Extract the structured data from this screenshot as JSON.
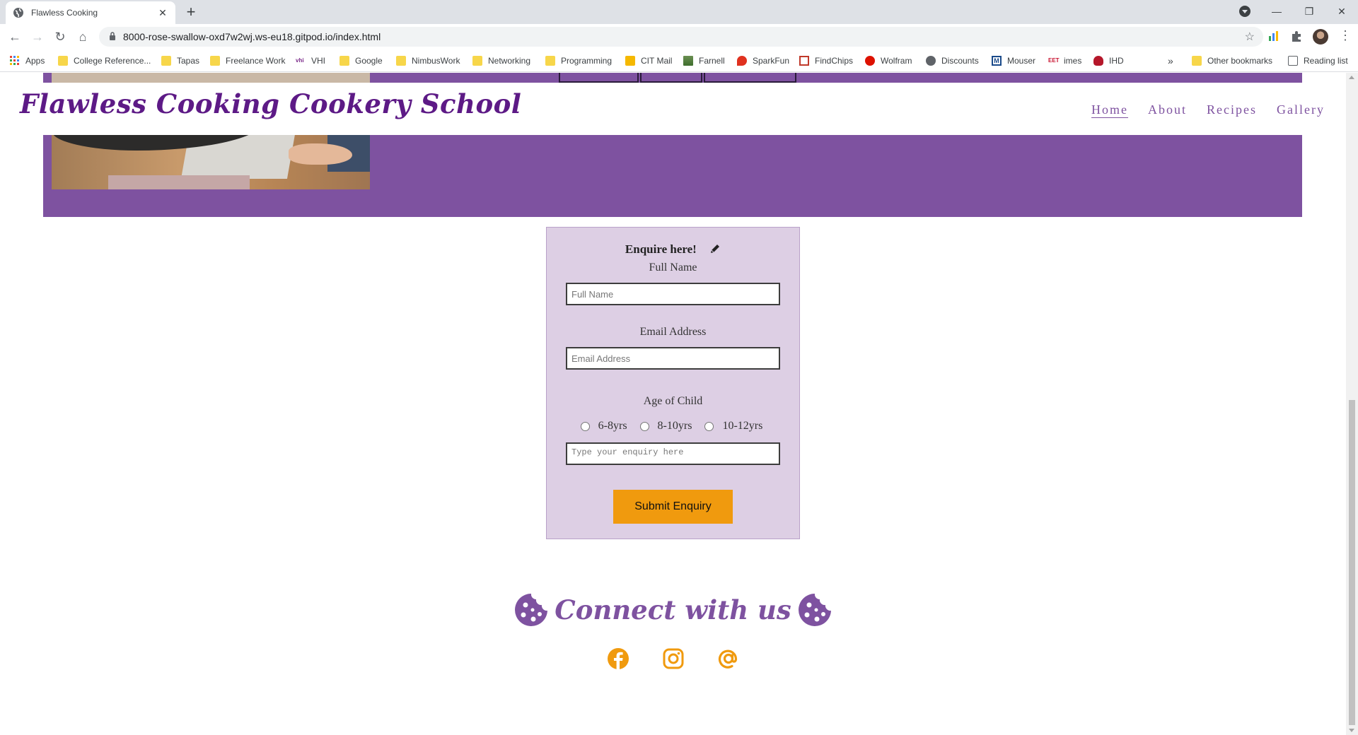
{
  "browser": {
    "tab_title": "Flawless Cooking",
    "url": "8000-rose-swallow-oxd7w2wj.ws-eu18.gitpod.io/index.html",
    "bookmarks": [
      {
        "label": "Apps",
        "icon": "apps-grid-icon"
      },
      {
        "label": "College Reference...",
        "icon": "folder-icon"
      },
      {
        "label": "Tapas",
        "icon": "folder-icon"
      },
      {
        "label": "Freelance Work",
        "icon": "folder-icon"
      },
      {
        "label": "VHI",
        "icon": "vhi-icon"
      },
      {
        "label": "Google",
        "icon": "folder-icon"
      },
      {
        "label": "NimbusWork",
        "icon": "folder-icon"
      },
      {
        "label": "Networking",
        "icon": "folder-icon"
      },
      {
        "label": "Programming",
        "icon": "folder-icon"
      },
      {
        "label": "CIT Mail",
        "icon": "cit-icon"
      },
      {
        "label": "Farnell",
        "icon": "farnell-icon"
      },
      {
        "label": "SparkFun",
        "icon": "sparkfun-icon"
      },
      {
        "label": "FindChips",
        "icon": "findchips-icon"
      },
      {
        "label": "Wolfram",
        "icon": "wolfram-icon"
      },
      {
        "label": "Discounts",
        "icon": "globe-icon"
      },
      {
        "label": "Mouser",
        "icon": "mouser-icon"
      },
      {
        "label": "imes",
        "icon": "eet-icon"
      },
      {
        "label": "IHD",
        "icon": "ihd-icon"
      }
    ],
    "more_bookmarks": "»",
    "other_bookmarks": "Other bookmarks",
    "reading_list": "Reading list"
  },
  "site": {
    "brand": "Flawless Cooking Cookery School",
    "nav": [
      {
        "label": "Home",
        "active": true
      },
      {
        "label": "About",
        "active": false
      },
      {
        "label": "Recipes",
        "active": false
      },
      {
        "label": "Gallery",
        "active": false
      }
    ],
    "colors": {
      "primary_purple": "#7e52a0",
      "brand_purple": "#5d1a86",
      "form_bg": "#ddcfe4",
      "accent_orange": "#f09a0e"
    }
  },
  "form": {
    "title": "Enquire here!",
    "title_icon": "pencil-icon",
    "full_name_label": "Full Name",
    "full_name_placeholder": "Full Name",
    "email_label": "Email Address",
    "email_placeholder": "Email Address",
    "age_label": "Age of Child",
    "age_options": [
      "6-8yrs",
      "8-10yrs",
      "10-12yrs"
    ],
    "enquiry_placeholder": "Type your enquiry here",
    "submit_label": "Submit Enquiry"
  },
  "footer": {
    "connect_text": "Connect with us",
    "socials": [
      {
        "name": "facebook-icon"
      },
      {
        "name": "instagram-icon"
      },
      {
        "name": "email-at-icon"
      }
    ]
  }
}
